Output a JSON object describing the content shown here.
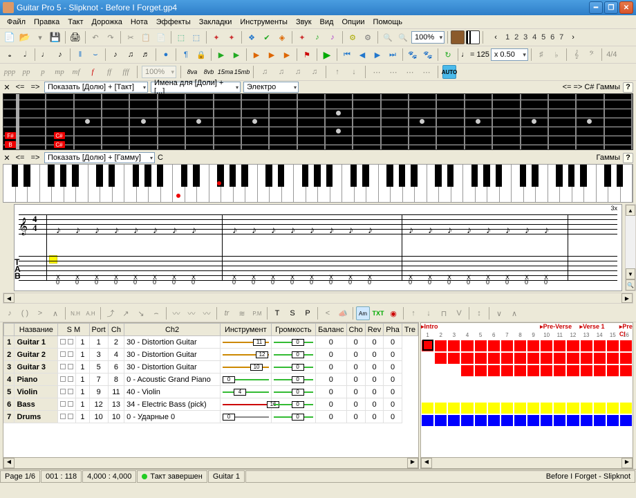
{
  "window": {
    "title": "Guitar Pro 5 - Slipknot - Before I Forget.gp4"
  },
  "menu": [
    "Файл",
    "Правка",
    "Такт",
    "Дорожка",
    "Нота",
    "Эффекты",
    "Закладки",
    "Инструменты",
    "Звук",
    "Вид",
    "Опции",
    "Помощь"
  ],
  "toolbar1": {
    "zoom": "100%",
    "goto_nums": [
      "1",
      "2",
      "3",
      "4",
      "5",
      "6",
      "7"
    ]
  },
  "toolbar2": {
    "pct": "100%",
    "tempo_label": "= 125",
    "speed": "x 0.50",
    "octaves": [
      "8va",
      "8vb",
      "15ma",
      "15mb"
    ],
    "note_symbol": "♩"
  },
  "fretpanel": {
    "show_label": "Показать [Долю] + [Такт]",
    "names_label": "Имена для [Доли] + [...]",
    "sound_label": "Электро",
    "tail": "<= => C#   Гаммы",
    "notes": [
      {
        "s": 4,
        "f": 0,
        "t": "F#"
      },
      {
        "s": 5,
        "f": 0,
        "t": "B"
      },
      {
        "s": 4,
        "f": 2,
        "t": "C#"
      },
      {
        "s": 5,
        "f": 2,
        "t": "C#"
      }
    ]
  },
  "pianopanel": {
    "show_label": "Показать [Долю] + [Гамму]",
    "key": "C",
    "tail": "Гаммы"
  },
  "score": {
    "bar_repeat": "3x",
    "time_sig": "4/4",
    "tab": [
      "T",
      "A",
      "B"
    ]
  },
  "track_headers": [
    "",
    "Название",
    "S",
    "M",
    "Port",
    "Ch",
    "Ch2",
    "Инструмент",
    "Громкость",
    "Баланс",
    "Cho",
    "Rev",
    "Pha",
    "Tre"
  ],
  "tracks": [
    {
      "n": 1,
      "name": "Guitar 1",
      "port": 1,
      "ch": 1,
      "ch2": 2,
      "instr": "30 - Distortion Guitar",
      "vol": 11,
      "volcol": "#c80",
      "bal": 0,
      "cho": 0,
      "rev": 0,
      "pha": 0,
      "tre": 0
    },
    {
      "n": 2,
      "name": "Guitar 2",
      "port": 1,
      "ch": 3,
      "ch2": 4,
      "instr": "30 - Distortion Guitar",
      "vol": 12,
      "volcol": "#c80",
      "bal": 0,
      "cho": 0,
      "rev": 0,
      "pha": 0,
      "tre": 0
    },
    {
      "n": 3,
      "name": "Guitar 3",
      "port": 1,
      "ch": 5,
      "ch2": 6,
      "instr": "30 - Distortion Guitar",
      "vol": 10,
      "volcol": "#c80",
      "bal": 0,
      "cho": 0,
      "rev": 0,
      "pha": 0,
      "tre": 0
    },
    {
      "n": 4,
      "name": "Piano",
      "port": 1,
      "ch": 7,
      "ch2": 8,
      "instr": "0 - Acoustic Grand Piano",
      "vol": 0,
      "volcol": "#3b3",
      "bal": 0,
      "cho": 0,
      "rev": 0,
      "pha": 0,
      "tre": 0
    },
    {
      "n": 5,
      "name": "Violin",
      "port": 1,
      "ch": 9,
      "ch2": 11,
      "instr": "40 - Violin",
      "vol": 4,
      "volcol": "#3b3",
      "bal": 0,
      "cho": 0,
      "rev": 0,
      "pha": 0,
      "tre": 0
    },
    {
      "n": 6,
      "name": "Bass",
      "port": 1,
      "ch": 12,
      "ch2": 13,
      "instr": "34 - Electric Bass (pick)",
      "vol": 16,
      "volcol": "#c00",
      "bal": 0,
      "cho": 0,
      "rev": 0,
      "pha": 0,
      "tre": 0
    },
    {
      "n": 7,
      "name": "Drums",
      "port": 1,
      "ch": 10,
      "ch2": 10,
      "instr": "0 - Ударные 0",
      "vol": 0,
      "volcol": "#888",
      "bal": 0,
      "cho": 0,
      "rev": 0,
      "pha": 0,
      "tre": 0
    }
  ],
  "arrange": {
    "markers": [
      {
        "pos": 0,
        "label": "Intro"
      },
      {
        "pos": 9,
        "label": "Pre-Verse"
      },
      {
        "pos": 12,
        "label": "Verse 1"
      },
      {
        "pos": 15,
        "label": "Pre-Cl"
      }
    ],
    "cols": 16,
    "rows": [
      {
        "fill": "r",
        "from": 0,
        "to": 16
      },
      {
        "fill": "r",
        "from": 1,
        "to": 16
      },
      {
        "fill": "r",
        "from": 3,
        "to": 16
      },
      {
        "fill": "",
        "from": 0,
        "to": 0
      },
      {
        "fill": "",
        "from": 0,
        "to": 0
      },
      {
        "fill": "y",
        "from": 0,
        "to": 16
      },
      {
        "fill": "b",
        "from": 0,
        "to": 16
      }
    ]
  },
  "status": {
    "page": "Page 1/6",
    "pos": "001 : 118",
    "time": "4,000 : 4,000",
    "bar_state": "Такт завершен",
    "track": "Guitar 1",
    "song": "Before I Forget - Slipknot"
  },
  "fx_labels": {
    "t": "T",
    "s": "S",
    "p": "P",
    "pm": "P.M",
    "txt": "TXT",
    "am": "Am"
  }
}
